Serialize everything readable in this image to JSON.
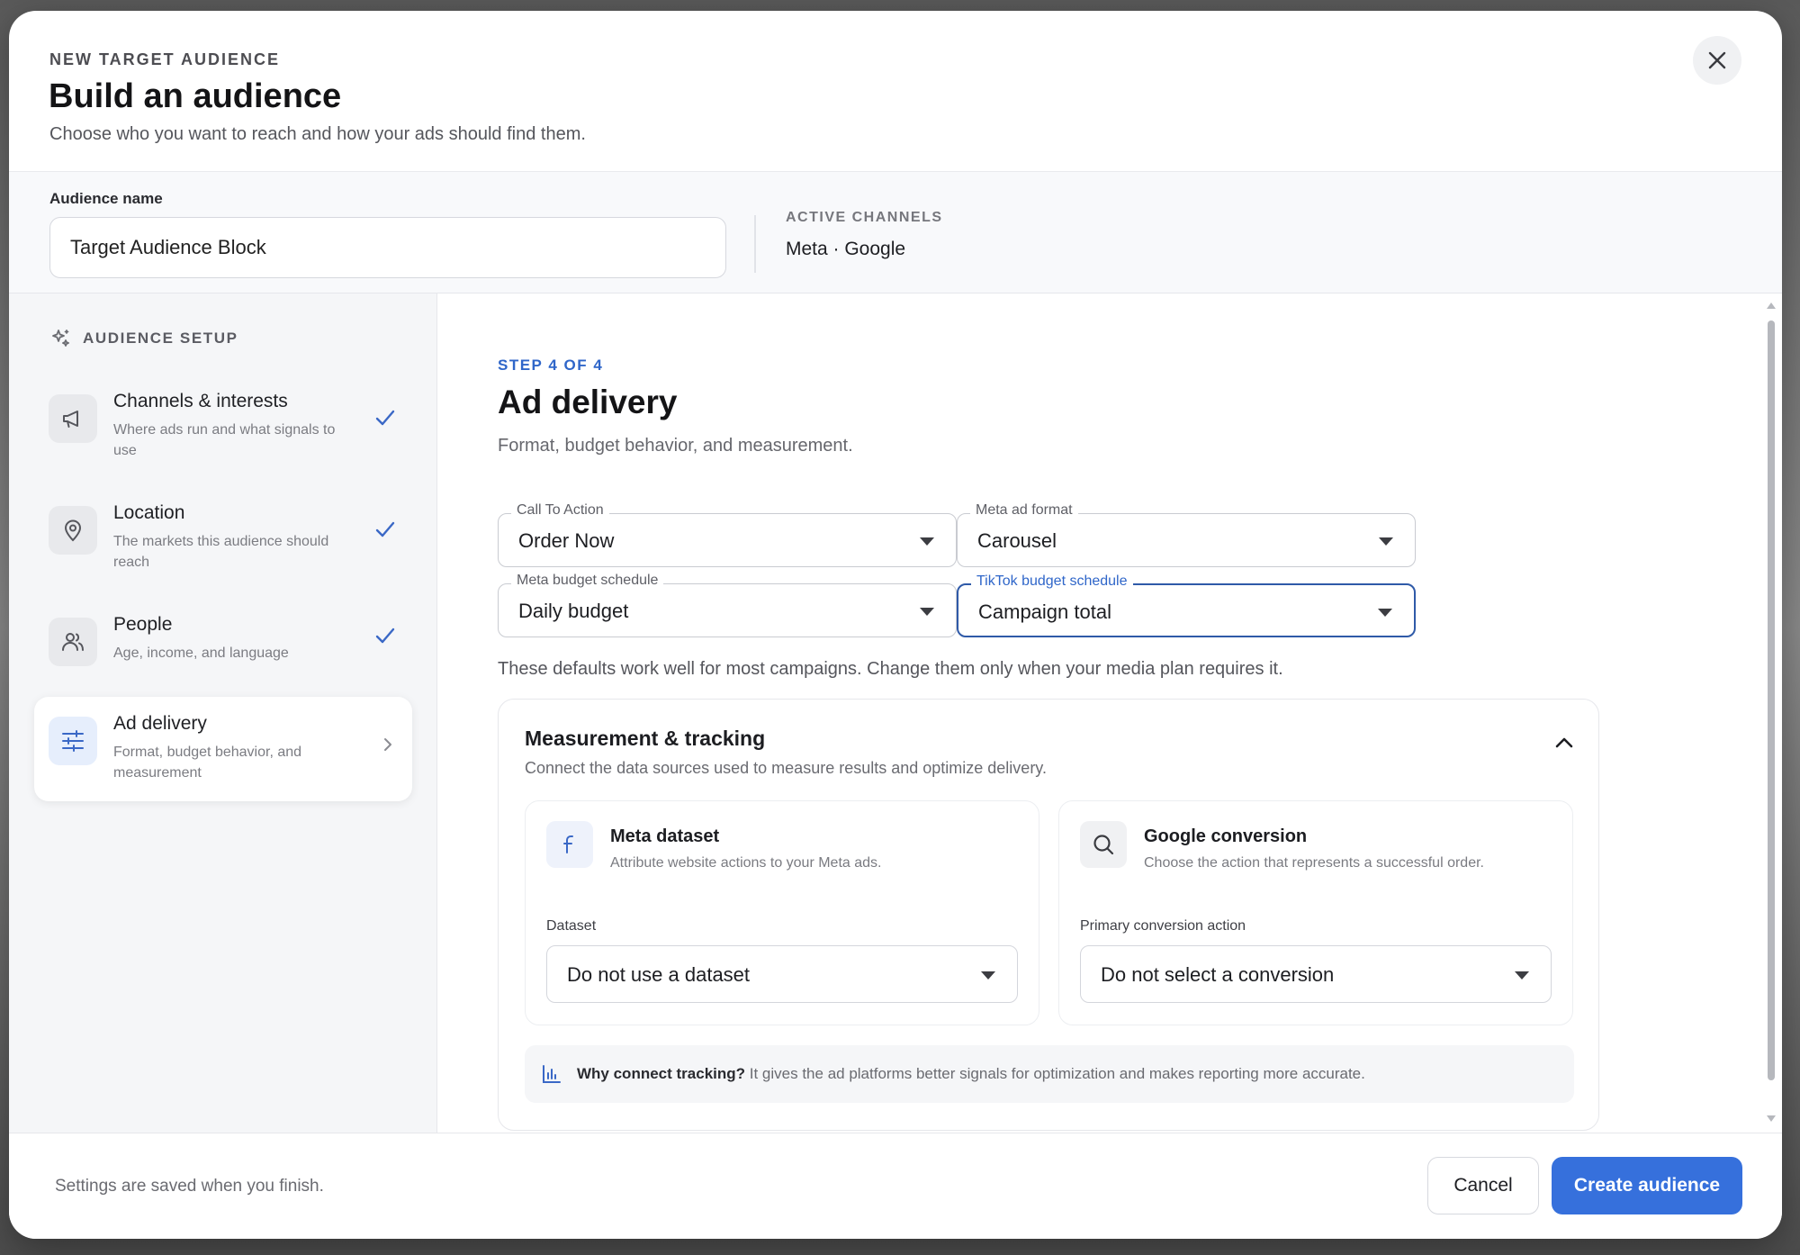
{
  "header": {
    "eyebrow": "NEW TARGET AUDIENCE",
    "title": "Build an audience",
    "subtitle": "Choose who you want to reach and how your ads should find them.",
    "close_icon": "close-icon"
  },
  "audience": {
    "name_label": "Audience name",
    "name_value": "Target Audience Block",
    "channels_label": "ACTIVE CHANNELS",
    "channels_value": "Meta · Google"
  },
  "sidebar": {
    "heading": "AUDIENCE SETUP",
    "heading_icon": "sparkle-icon",
    "steps": [
      {
        "title": "Channels & interests",
        "desc": "Where ads run and what signals to use",
        "icon": "megaphone-icon",
        "status": "complete"
      },
      {
        "title": "Location",
        "desc": "The markets this audience should reach",
        "icon": "map-pin-icon",
        "status": "complete"
      },
      {
        "title": "People",
        "desc": "Age, income, and language",
        "icon": "people-icon",
        "status": "complete"
      },
      {
        "title": "Ad delivery",
        "desc": "Format, budget behavior, and measurement",
        "icon": "sliders-icon",
        "status": "current"
      }
    ]
  },
  "main": {
    "step_indicator": "STEP 4 OF 4",
    "title": "Ad delivery",
    "subtitle": "Format, budget behavior, and measurement.",
    "fields": {
      "call_to_action": {
        "label": "Call To Action",
        "value": "Order Now"
      },
      "meta_ad_format": {
        "label": "Meta ad format",
        "value": "Carousel"
      },
      "meta_budget_schedule": {
        "label": "Meta budget schedule",
        "value": "Daily budget"
      },
      "tiktok_budget_schedule": {
        "label": "TikTok budget schedule",
        "value": "Campaign total"
      }
    },
    "defaults_note": "These defaults work well for most campaigns. Change them only when your media plan requires it.",
    "measurement": {
      "title": "Measurement & tracking",
      "subtitle": "Connect the data sources used to measure results and optimize delivery.",
      "meta": {
        "title": "Meta dataset",
        "desc": "Attribute website actions to your Meta ads.",
        "field_label": "Dataset",
        "value": "Do not use a dataset"
      },
      "google": {
        "title": "Google conversion",
        "desc": "Choose the action that represents a successful order.",
        "field_label": "Primary conversion action",
        "value": "Do not select a conversion"
      },
      "info_strong": "Why connect tracking?",
      "info_text": " It gives the ad platforms better signals for optimization and makes reporting more accurate."
    }
  },
  "footer": {
    "note": "Settings are saved when you finish.",
    "cancel_label": "Cancel",
    "create_label": "Create audience"
  },
  "colors": {
    "accent": "#3670dc",
    "accent_text": "#2f66c9",
    "focus_border": "#2f5aa8"
  }
}
